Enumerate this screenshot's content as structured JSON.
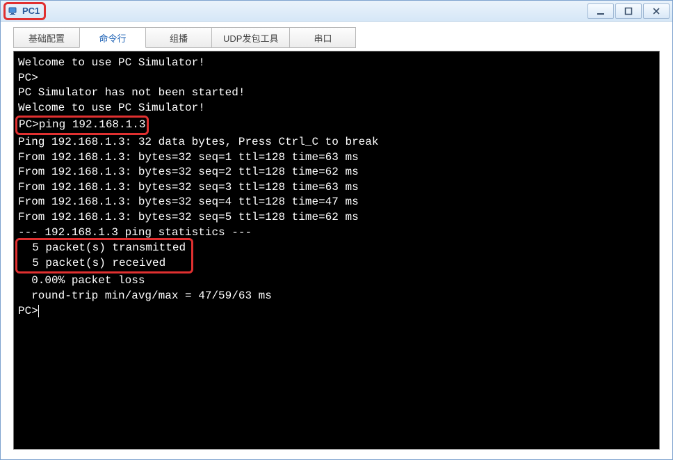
{
  "window": {
    "title": "PC1"
  },
  "tabs": [
    {
      "label": "基础配置"
    },
    {
      "label": "命令行"
    },
    {
      "label": "组播"
    },
    {
      "label": "UDP发包工具"
    },
    {
      "label": "串口"
    }
  ],
  "activeTabIndex": 1,
  "terminal": {
    "welcome1": "Welcome to use PC Simulator!",
    "blank": "",
    "prompt1": "PC>",
    "notStarted": "PC Simulator has not been started!",
    "welcome2": "Welcome to use PC Simulator!",
    "pingCmd": "PC>ping 192.168.1.3",
    "pingHeader": "Ping 192.168.1.3: 32 data bytes, Press Ctrl_C to break",
    "reply1": "From 192.168.1.3: bytes=32 seq=1 ttl=128 time=63 ms",
    "reply2": "From 192.168.1.3: bytes=32 seq=2 ttl=128 time=62 ms",
    "reply3": "From 192.168.1.3: bytes=32 seq=3 ttl=128 time=63 ms",
    "reply4": "From 192.168.1.3: bytes=32 seq=4 ttl=128 time=47 ms",
    "reply5": "From 192.168.1.3: bytes=32 seq=5 ttl=128 time=62 ms",
    "statsHeader": "--- 192.168.1.3 ping statistics ---",
    "statsTx": "  5 packet(s) transmitted",
    "statsRx": "  5 packet(s) received",
    "statsLoss": "  0.00% packet loss",
    "statsRtt": "  round-trip min/avg/max = 47/59/63 ms",
    "prompt2": "PC>"
  }
}
